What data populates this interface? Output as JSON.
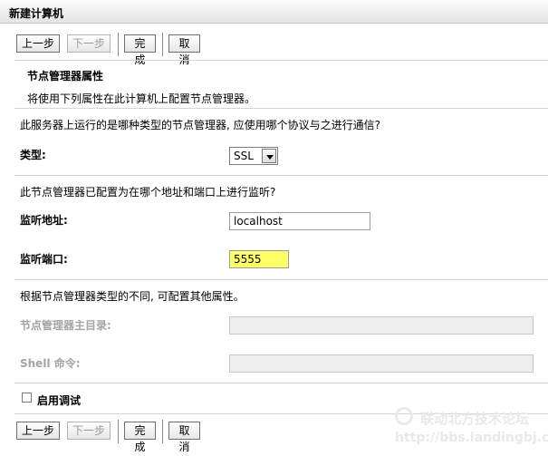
{
  "window": {
    "title": "新建计算机"
  },
  "toolbar": {
    "prev_label": "上一步",
    "next_label": "下一步",
    "finish_label": "完成",
    "cancel_label": "取消"
  },
  "section": {
    "heading": "节点管理器属性",
    "description": "将使用下列属性在此计算机上配置节点管理器。"
  },
  "type_group": {
    "question": "此服务器上运行的是哪种类型的节点管理器, 应使用哪个协议与之进行通信?",
    "label": "类型:",
    "selected": "SSL"
  },
  "listen_group": {
    "question": "此节点管理器已配置为在哪个地址和端口上进行监听?",
    "address_label": "监听地址:",
    "address_value": "localhost",
    "port_label": "监听端口:",
    "port_value": "5555"
  },
  "other_group": {
    "note": "根据节点管理器类型的不同, 可配置其他属性。",
    "home_label": "节点管理器主目录:",
    "shell_label": "Shell 命令:"
  },
  "debug": {
    "label": "启用调试",
    "checked": false
  },
  "watermark": {
    "line1": "联动北方技术论坛",
    "line2": "http://bbs.landingbj.com"
  }
}
